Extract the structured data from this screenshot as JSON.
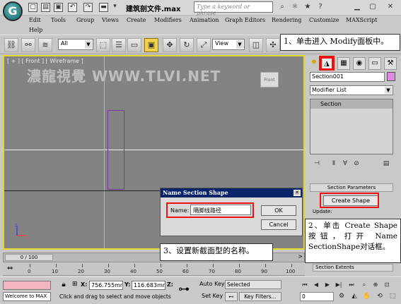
{
  "app": {
    "logo_glyph": "G",
    "document_title": "建筑剖文件.max",
    "search_placeholder": "Type a keyword or phrase"
  },
  "menu": [
    "Edit",
    "Tools",
    "Group",
    "Views",
    "Create",
    "Modifiers",
    "Animation",
    "Graph Editors",
    "Rendering",
    "Customize",
    "MAXScript",
    "Help"
  ],
  "toolbar": {
    "selection_filter": "All",
    "ref_coord": "View"
  },
  "viewport": {
    "label": "[ + ] [ Front ] [ Wireframe ]",
    "watermark": "濃龍視覺 WWW.TLVI.NET",
    "viewcube_label": "Front"
  },
  "command_panel": {
    "object_name": "Section001",
    "modifier_list": "Modifier List",
    "stack_item": "Section",
    "rollout_title": "Section Parameters",
    "create_shape_label": "Create Shape",
    "update_label": "Update:",
    "section_extents": "Section Extents"
  },
  "dialog": {
    "title": "Name Section Shape",
    "name_label": "Name:",
    "name_value": "隔脚线路径",
    "ok_label": "OK",
    "cancel_label": "Cancel"
  },
  "timeline": {
    "frame_display": "0 / 100",
    "ticks": [
      "0",
      "10",
      "20",
      "30",
      "40",
      "50",
      "60",
      "70",
      "80",
      "90",
      "100"
    ]
  },
  "status": {
    "welcome": "Welcome to MAX",
    "prompt": "Click and drag to select and move objects",
    "x_label": "X:",
    "x_value": "756.755mr",
    "y_label": "Y:",
    "y_value": "116.683mr",
    "z_label": "Z:",
    "auto_key": "Auto Key",
    "set_key": "Set Key",
    "key_mode": "Selected",
    "key_filters": "Key Filters...",
    "current_frame": "0"
  },
  "annotations": {
    "step1": "1、单击进入 Modify面板中。",
    "step2": "2、单击 Create Shape 按钮，打开 Name SectionShape对话框。",
    "step3": "3、设置新截面型的名称。"
  },
  "colors": {
    "highlight_red": "#ee1111",
    "viewport_border": "#e4d82c",
    "viewport_bg": "#838383",
    "section_outline": "#7a34a6",
    "dialog_title_bg": "#0a246a"
  }
}
